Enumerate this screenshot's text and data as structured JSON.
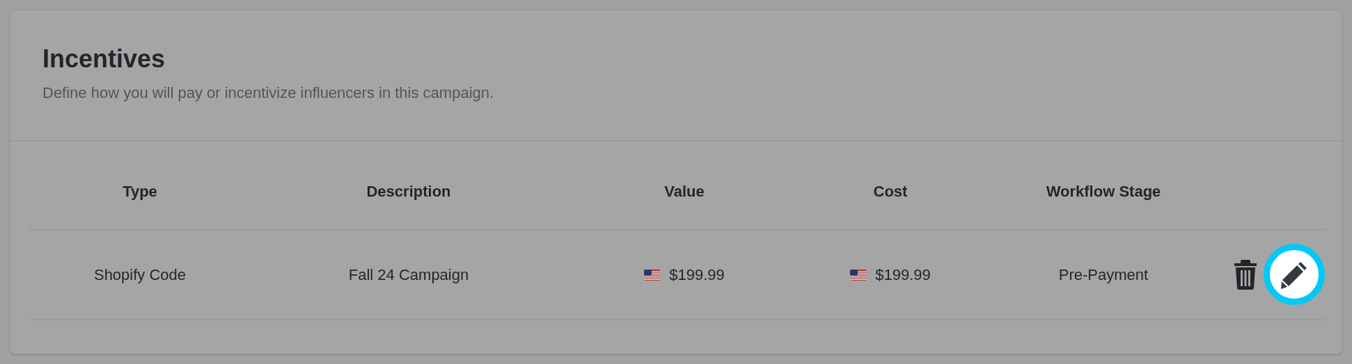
{
  "card": {
    "title": "Incentives",
    "subtitle": "Define how you will pay or incentivize influencers in this campaign."
  },
  "table": {
    "columns": [
      "Type",
      "Description",
      "Value",
      "Cost",
      "Workflow Stage"
    ],
    "rows": [
      {
        "type": "Shopify Code",
        "description": "Fall 24 Campaign",
        "value": "$199.99",
        "cost": "$199.99",
        "stage": "Pre-Payment",
        "actions": [
          {
            "kind": "delete",
            "highlighted": false
          },
          {
            "kind": "edit",
            "highlighted": true
          }
        ]
      }
    ]
  }
}
